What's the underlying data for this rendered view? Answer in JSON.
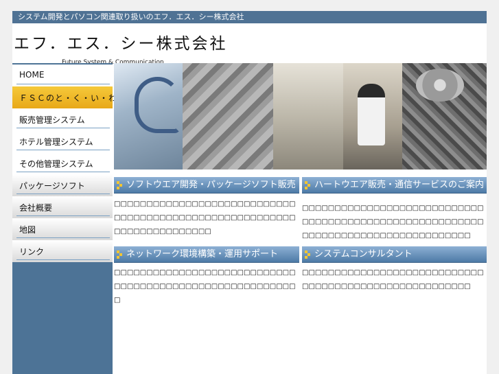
{
  "topbar": {
    "text": "システム開発とパソコン関連取り扱いのエフ．エス．シー株式会社"
  },
  "header": {
    "logo_jp": "エフ．エス．シー株式会社",
    "logo_en": "Future System & Communication"
  },
  "sidebar": {
    "items": [
      {
        "label": "HOME",
        "active": false
      },
      {
        "label": "ＦＳＣのと・く・い・わ・ざ",
        "active": true
      },
      {
        "label": "販売管理システム",
        "active": false
      },
      {
        "label": "ホテル管理システム",
        "active": false
      },
      {
        "label": "その他管理システム",
        "active": false
      },
      {
        "label": "パッケージソフト",
        "active": false
      },
      {
        "label": "会社概要",
        "active": false
      },
      {
        "label": "地図",
        "active": false
      },
      {
        "label": "リンク",
        "active": false
      }
    ]
  },
  "sections": [
    {
      "title": "ソフトウエア開発・パッケージソフト販売",
      "body": "□□□□□□□□□□□□□□□□□□□□□□□□□□□□□□□□□□□□□□□□□□□□□□□□□□□□□□□□□□□□□□□□□□□□□□□"
    },
    {
      "title": "ハートウエア販売・通信サービスのご案内",
      "body": "□□□□□□□□□□□□□□□□□□□□□□□□□□□□□□□□□□□□□□□□□□□□□□□□□□□□□□□□□□□□□□□□□□□□□□□□□□□□□□□□□□"
    },
    {
      "title": "ネットワーク環境構築・運用サポート",
      "body": "□□□□□□□□□□□□□□□□□□□□□□□□□□□□□□□□□□□□□□□□□□□□□□□□□□□□□□□□□"
    },
    {
      "title": "システムコンサルタント",
      "body": "□□□□□□□□□□□□□□□□□□□□□□□□□□□□□□□□□□□□□□□□□□□□□□□□□□□□□□"
    }
  ],
  "colors": {
    "accent": "#4d7396",
    "active_nav": "#f0bd2c",
    "header_bar": "#4f7294"
  }
}
